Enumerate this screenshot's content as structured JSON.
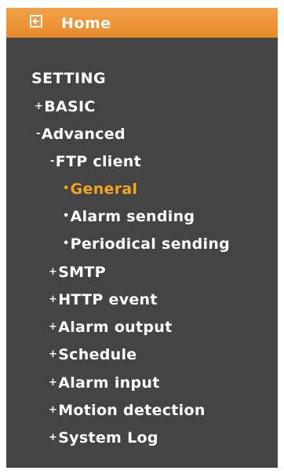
{
  "header": {
    "title": "Home",
    "icon": "back-arrow-icon"
  },
  "menu": {
    "section_title": "SETTING",
    "basic": {
      "prefix": "+",
      "label": "BASIC"
    },
    "advanced": {
      "prefix": "-",
      "label": "Advanced"
    },
    "ftp_client": {
      "prefix": "-",
      "label": "FTP client"
    },
    "general": {
      "prefix": "•",
      "label": "General"
    },
    "alarm_sending": {
      "prefix": "•",
      "label": "Alarm sending"
    },
    "periodical_sending": {
      "prefix": "•",
      "label": "Periodical sending"
    },
    "smtp": {
      "prefix": "+",
      "label": "SMTP"
    },
    "http_event": {
      "prefix": "+",
      "label": "HTTP event"
    },
    "alarm_output": {
      "prefix": "+",
      "label": "Alarm output"
    },
    "schedule": {
      "prefix": "+",
      "label": "Schedule"
    },
    "alarm_input": {
      "prefix": "+",
      "label": "Alarm input"
    },
    "motion_detection": {
      "prefix": "+",
      "label": "Motion detection"
    },
    "system_log": {
      "prefix": "+",
      "label": "System Log"
    }
  },
  "colors": {
    "header_bg": "#e98a2a",
    "panel_bg": "#444444",
    "text": "#ffffff",
    "active": "#f2a61e"
  }
}
